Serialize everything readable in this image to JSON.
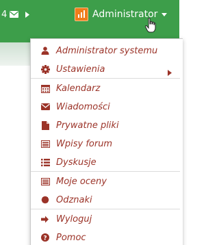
{
  "navbar": {
    "message_count": "4",
    "envelope_icon": "envelope-icon",
    "arrow_icon": "arrow-right-icon",
    "user_name": "Administrator",
    "caret_icon": "caret-down-icon",
    "colors": {
      "bar": "#3d9e4a",
      "user_pic": "#f07d1b"
    }
  },
  "menu": {
    "text_color": "#9b3328",
    "items": [
      {
        "label": "Administrator systemu",
        "icon": "user-icon"
      },
      {
        "label": "Ustawienia",
        "icon": "gear-icon",
        "has_submenu": true
      },
      {
        "label": "Kalendarz",
        "icon": "calendar-icon"
      },
      {
        "label": "Wiadomości",
        "icon": "envelope-icon"
      },
      {
        "label": "Prywatne pliki",
        "icon": "file-icon"
      },
      {
        "label": "Wpisy forum",
        "icon": "list-alt-icon"
      },
      {
        "label": "Dyskusje",
        "icon": "list-icon"
      },
      {
        "label": "Moje oceny",
        "icon": "grades-icon"
      },
      {
        "label": "Odznaki",
        "icon": "certificate-icon"
      },
      {
        "label": "Wyloguj",
        "icon": "sign-out-icon"
      },
      {
        "label": "Pomoc",
        "icon": "question-circle-icon"
      }
    ]
  }
}
